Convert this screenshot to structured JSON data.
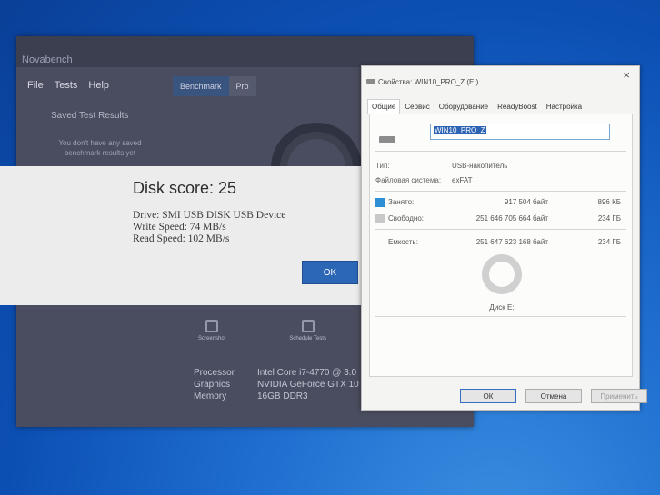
{
  "novabench": {
    "title": "Novabench",
    "menu": [
      "File",
      "Tests",
      "Help"
    ],
    "saved_title": "Saved Test Results",
    "saved_message": "You don't have any saved benchmark results yet",
    "tabs": [
      "Benchmark",
      "Pro"
    ],
    "icons": [
      "Screenshot",
      "Schedule Tests"
    ],
    "specs": [
      {
        "label": "Processor",
        "value": "Intel Core i7-4770 @ 3.0"
      },
      {
        "label": "Graphics",
        "value": "NVIDIA GeForce GTX 10"
      },
      {
        "label": "Memory",
        "value": "16GB DDR3"
      }
    ]
  },
  "score_dialog": {
    "title": "Disk score: 25",
    "drive": "Drive: SMI USB DISK USB Device",
    "write": "Write Speed: 74 MB/s",
    "read": "Read Speed: 102 MB/s",
    "ok": "OK"
  },
  "properties": {
    "title": "Свойства: WIN10_PRO_Z (E:)",
    "close": "×",
    "tabs": [
      "Общие",
      "Сервис",
      "Оборудование",
      "ReadyBoost",
      "Настройка"
    ],
    "name": "WIN10_PRO_Z",
    "type_label": "Тип:",
    "type_value": "USB-накопитель",
    "fs_label": "Файловая система:",
    "fs_value": "exFAT",
    "used": {
      "label": "Занято:",
      "bytes": "917 504 байт",
      "size": "896 КБ",
      "color": "#2d8fd6"
    },
    "free": {
      "label": "Свободно:",
      "bytes": "251 646 705 664 байт",
      "size": "234 ГБ",
      "color": "#c8c8c8"
    },
    "capacity": {
      "label": "Емкость:",
      "bytes": "251 647 623 168 байт",
      "size": "234 ГБ"
    },
    "disk_label": "Диск E:",
    "buttons": {
      "ok": "ОК",
      "cancel": "Отмена",
      "apply": "Применить"
    }
  }
}
